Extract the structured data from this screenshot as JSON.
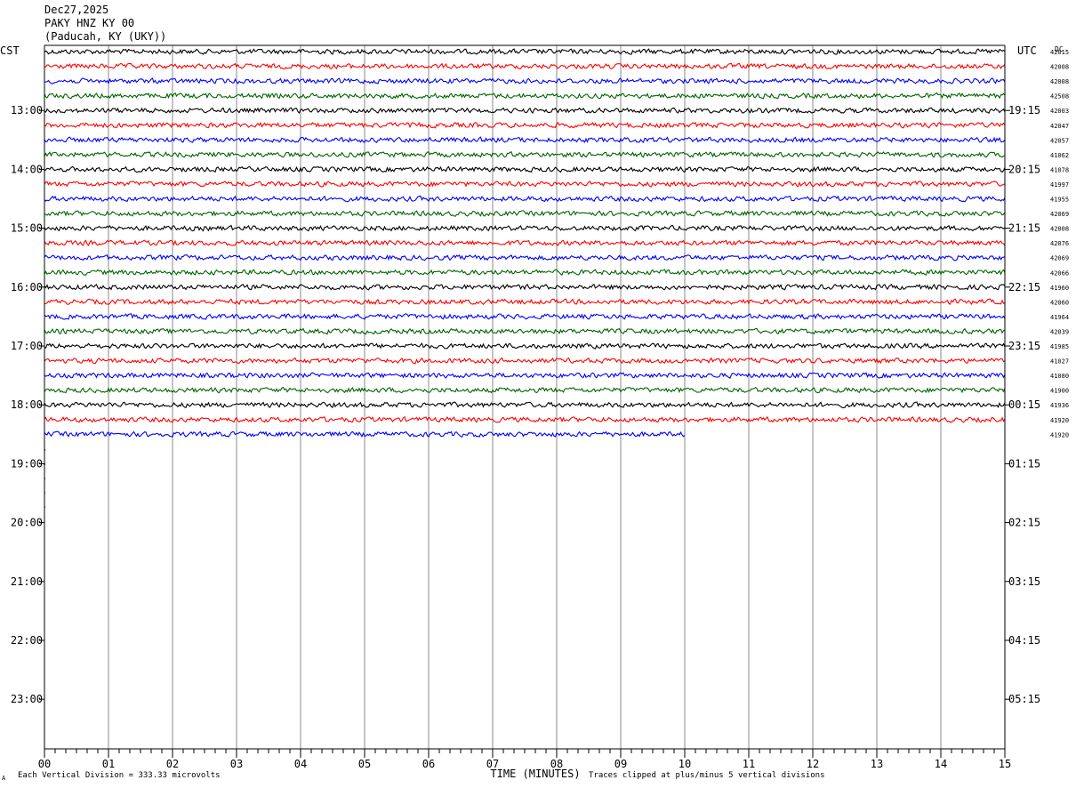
{
  "header": {
    "date": "Dec27,2025",
    "station": "PAKY HNZ KY 00",
    "location": "(Paducah, KY (UKY))"
  },
  "footer": {
    "mark": "A",
    "scale_note": "Each Vertical Division = 333.33 microvolts",
    "clip_note": "Traces clipped at plus/minus 5 vertical divisions"
  },
  "chart_data": {
    "type": "line",
    "xlabel": "TIME (MINUTES)",
    "x_ticks": [
      "00",
      "01",
      "02",
      "03",
      "04",
      "05",
      "06",
      "07",
      "08",
      "09",
      "10",
      "11",
      "12",
      "13",
      "14",
      "15"
    ],
    "xlim": [
      0,
      15
    ],
    "left_axis_title": "CST",
    "right_axis_title": "UTC",
    "dc_title": "DC",
    "left_hour_labels": [
      "13:00",
      "14:00",
      "15:00",
      "16:00",
      "17:00",
      "18:00",
      "19:00",
      "20:00",
      "21:00",
      "22:00",
      "23:00"
    ],
    "right_hour_labels": [
      "19:15",
      "20:15",
      "21:15",
      "22:15",
      "23:15",
      "00:15",
      "01:15",
      "02:15",
      "03:15",
      "04:15",
      "05:15"
    ],
    "trace_colors": [
      "#000000",
      "#ff0000",
      "#0000ff",
      "#006400"
    ],
    "grid": "vertical lines at each minute",
    "rows_per_hour": 4,
    "series": [
      {
        "dc": "42015",
        "end_minute": 15
      },
      {
        "dc": "42008",
        "end_minute": 15
      },
      {
        "dc": "42008",
        "end_minute": 15
      },
      {
        "dc": "42508",
        "end_minute": 15
      },
      {
        "dc": "42003",
        "end_minute": 15
      },
      {
        "dc": "42047",
        "end_minute": 15
      },
      {
        "dc": "42057",
        "end_minute": 15
      },
      {
        "dc": "41062",
        "end_minute": 15
      },
      {
        "dc": "41078",
        "end_minute": 15
      },
      {
        "dc": "41997",
        "end_minute": 15
      },
      {
        "dc": "41955",
        "end_minute": 15
      },
      {
        "dc": "42069",
        "end_minute": 15
      },
      {
        "dc": "42008",
        "end_minute": 15
      },
      {
        "dc": "42076",
        "end_minute": 15
      },
      {
        "dc": "42069",
        "end_minute": 15
      },
      {
        "dc": "42066",
        "end_minute": 15
      },
      {
        "dc": "41960",
        "end_minute": 15
      },
      {
        "dc": "42060",
        "end_minute": 15
      },
      {
        "dc": "41964",
        "end_minute": 15
      },
      {
        "dc": "42039",
        "end_minute": 15
      },
      {
        "dc": "41985",
        "end_minute": 15
      },
      {
        "dc": "41027",
        "end_minute": 15
      },
      {
        "dc": "41080",
        "end_minute": 15
      },
      {
        "dc": "41900",
        "end_minute": 15
      },
      {
        "dc": "41936",
        "end_minute": 15
      },
      {
        "dc": "41920",
        "end_minute": 15
      },
      {
        "dc": "41920",
        "end_minute": 10
      }
    ]
  }
}
